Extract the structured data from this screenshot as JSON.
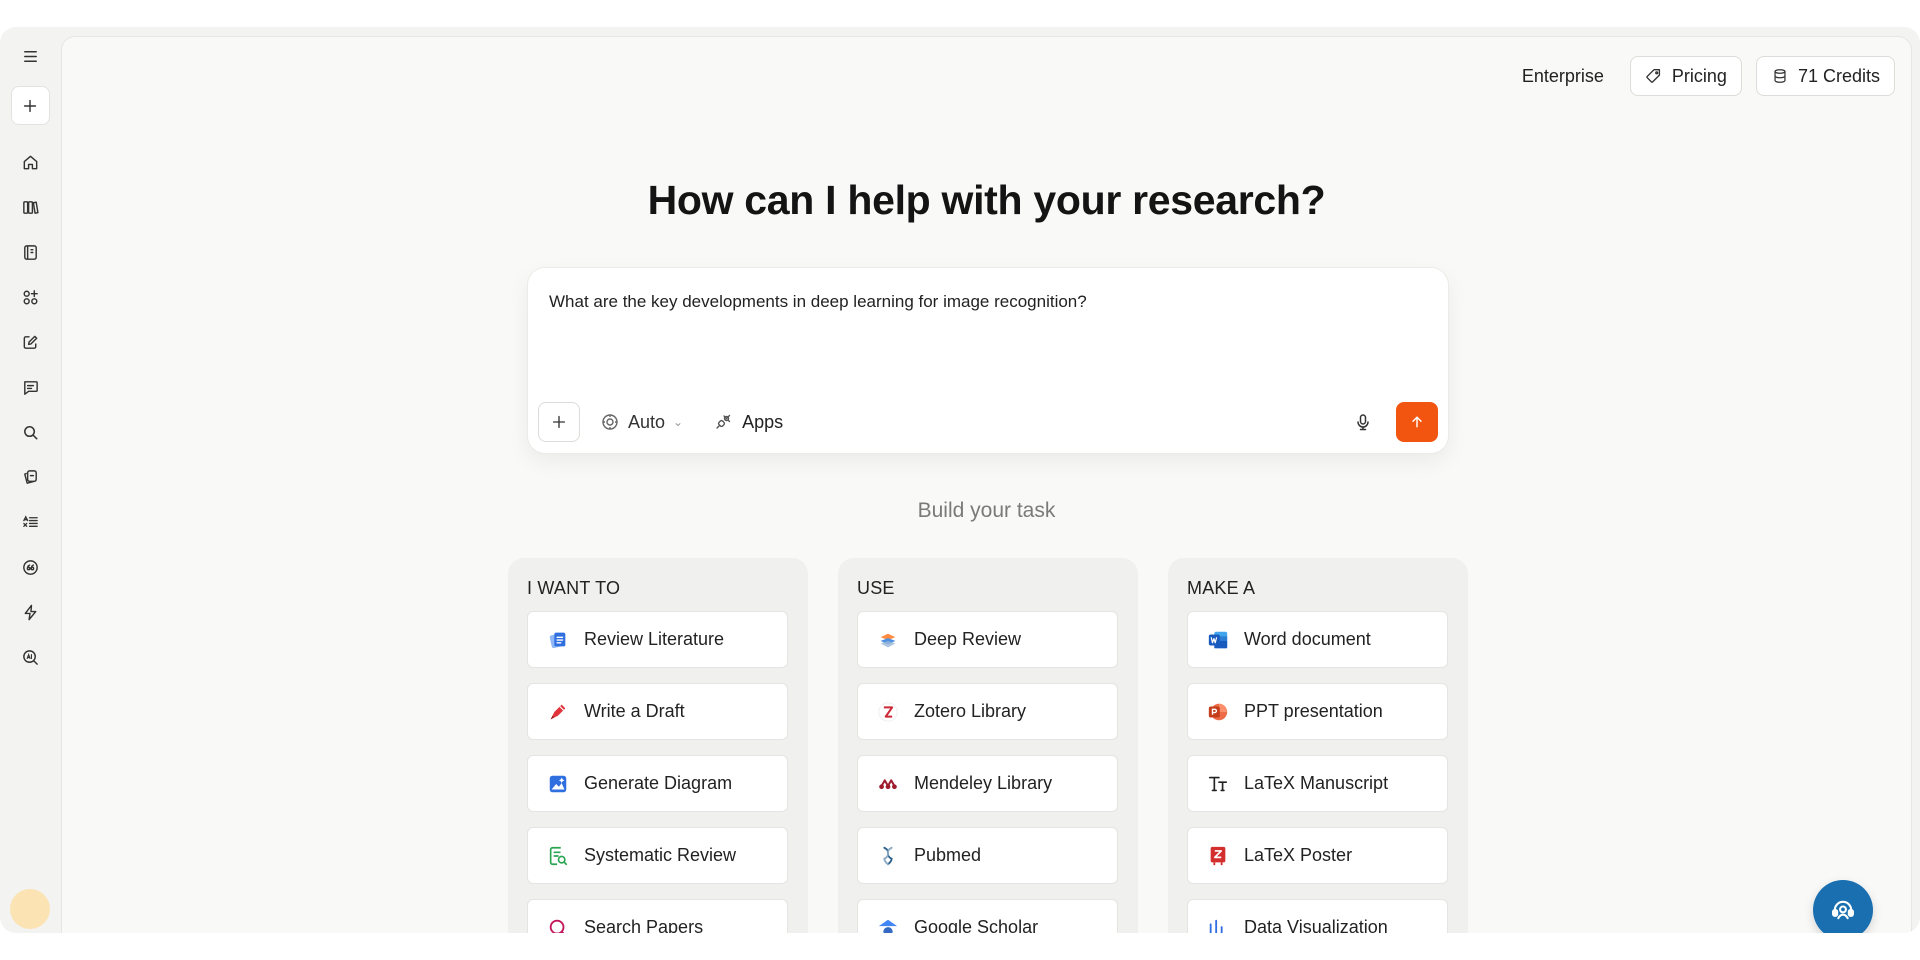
{
  "sidebar": {
    "items": [
      {
        "icon": "home-icon"
      },
      {
        "icon": "library-icon"
      },
      {
        "icon": "notebook-icon"
      },
      {
        "icon": "apps-grid-icon"
      },
      {
        "icon": "edit-icon"
      },
      {
        "icon": "chat-icon"
      },
      {
        "icon": "search-icon"
      },
      {
        "icon": "cards-icon"
      },
      {
        "icon": "outline-icon"
      },
      {
        "icon": "quote-icon"
      },
      {
        "icon": "lightning-icon"
      },
      {
        "icon": "ai-search-icon"
      }
    ]
  },
  "header": {
    "enterprise_label": "Enterprise",
    "pricing_label": "Pricing",
    "credits_label": "71 Credits"
  },
  "main": {
    "headline": "How can I help with your research?",
    "composer": {
      "text": "What are the key developments in deep learning for image recognition?",
      "mode_label": "Auto",
      "apps_label": "Apps",
      "send_color": "#f2550f"
    },
    "build_title": "Build your task",
    "columns": [
      {
        "title": "I WANT TO",
        "items": [
          {
            "label": "Review Literature",
            "icon": "review-literature-icon"
          },
          {
            "label": "Write a Draft",
            "icon": "write-draft-icon"
          },
          {
            "label": "Generate Diagram",
            "icon": "generate-diagram-icon"
          },
          {
            "label": "Systematic Review",
            "icon": "systematic-review-icon"
          },
          {
            "label": "Search Papers",
            "icon": "search-papers-icon"
          }
        ]
      },
      {
        "title": "USE",
        "items": [
          {
            "label": "Deep Review",
            "icon": "deep-review-icon"
          },
          {
            "label": "Zotero Library",
            "icon": "zotero-icon"
          },
          {
            "label": "Mendeley Library",
            "icon": "mendeley-icon"
          },
          {
            "label": "Pubmed",
            "icon": "pubmed-icon"
          },
          {
            "label": "Google Scholar",
            "icon": "google-scholar-icon"
          }
        ]
      },
      {
        "title": "MAKE A",
        "items": [
          {
            "label": "Word document",
            "icon": "word-icon"
          },
          {
            "label": "PPT presentation",
            "icon": "powerpoint-icon"
          },
          {
            "label": "LaTeX Manuscript",
            "icon": "latex-manuscript-icon"
          },
          {
            "label": "LaTeX Poster",
            "icon": "latex-poster-icon"
          },
          {
            "label": "Data Visualization",
            "icon": "data-visualization-icon"
          }
        ]
      }
    ]
  },
  "colors": {
    "accent": "#f2550f",
    "support": "#1a6fb0"
  }
}
